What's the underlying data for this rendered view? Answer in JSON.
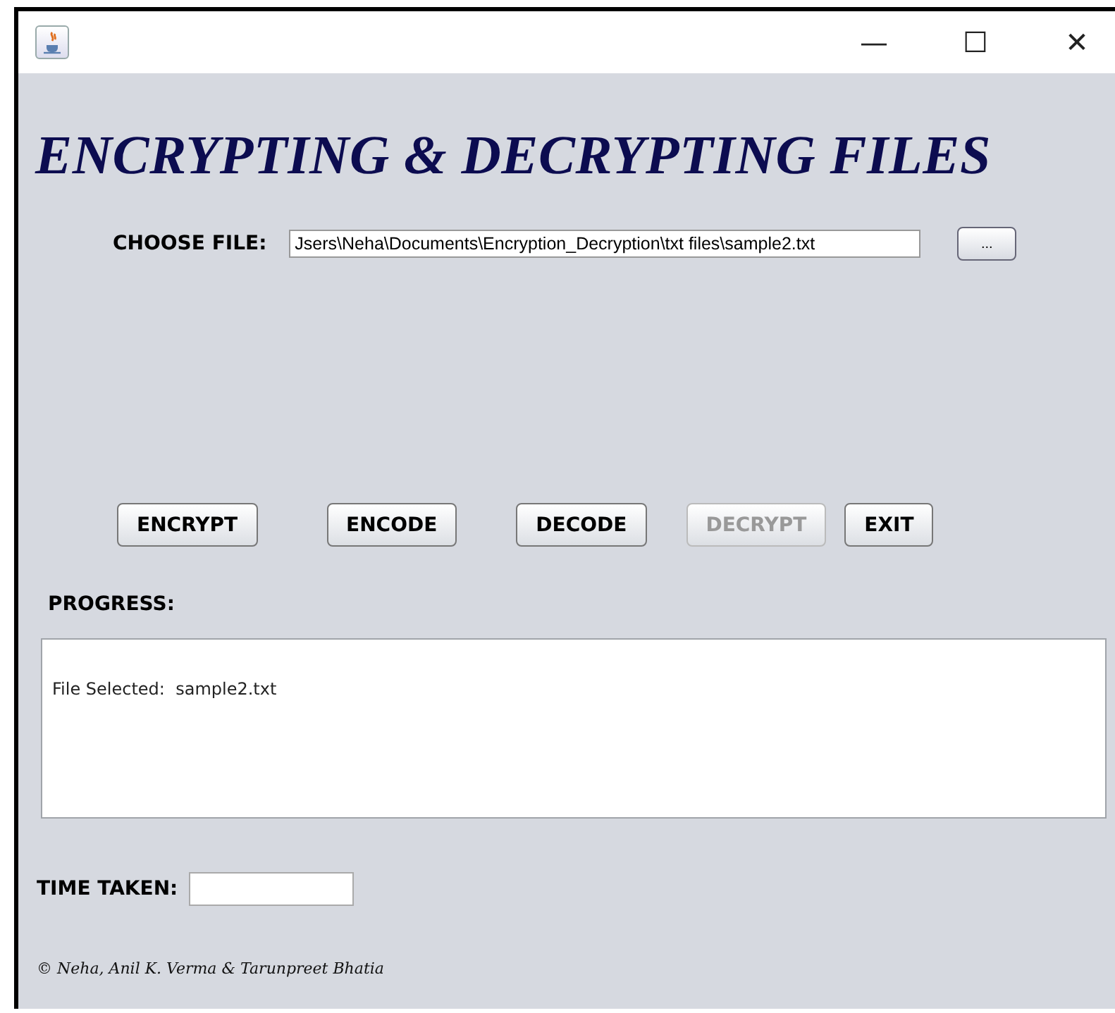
{
  "window": {
    "controls": [
      "—",
      "☐",
      "✕"
    ]
  },
  "heading": "ENCRYPTING & DECRYPTING FILES",
  "choose_file": {
    "label": "CHOOSE FILE:",
    "value": "Jsers\\Neha\\Documents\\Encryption_Decryption\\txt files\\sample2.txt",
    "browse": "..."
  },
  "buttons": [
    {
      "label": "ENCRYPT",
      "disabled": false
    },
    {
      "label": "ENCODE",
      "disabled": false
    },
    {
      "label": "DECODE",
      "disabled": false
    },
    {
      "label": "DECRYPT",
      "disabled": true
    },
    {
      "label": "EXIT",
      "disabled": false
    }
  ],
  "progress": {
    "label": "PROGRESS:",
    "text": "File Selected:  sample2.txt"
  },
  "time_taken": {
    "label": "TIME TAKEN:"
  },
  "footer": "© Neha, Anil K. Verma & Tarunpreet Bhatia"
}
